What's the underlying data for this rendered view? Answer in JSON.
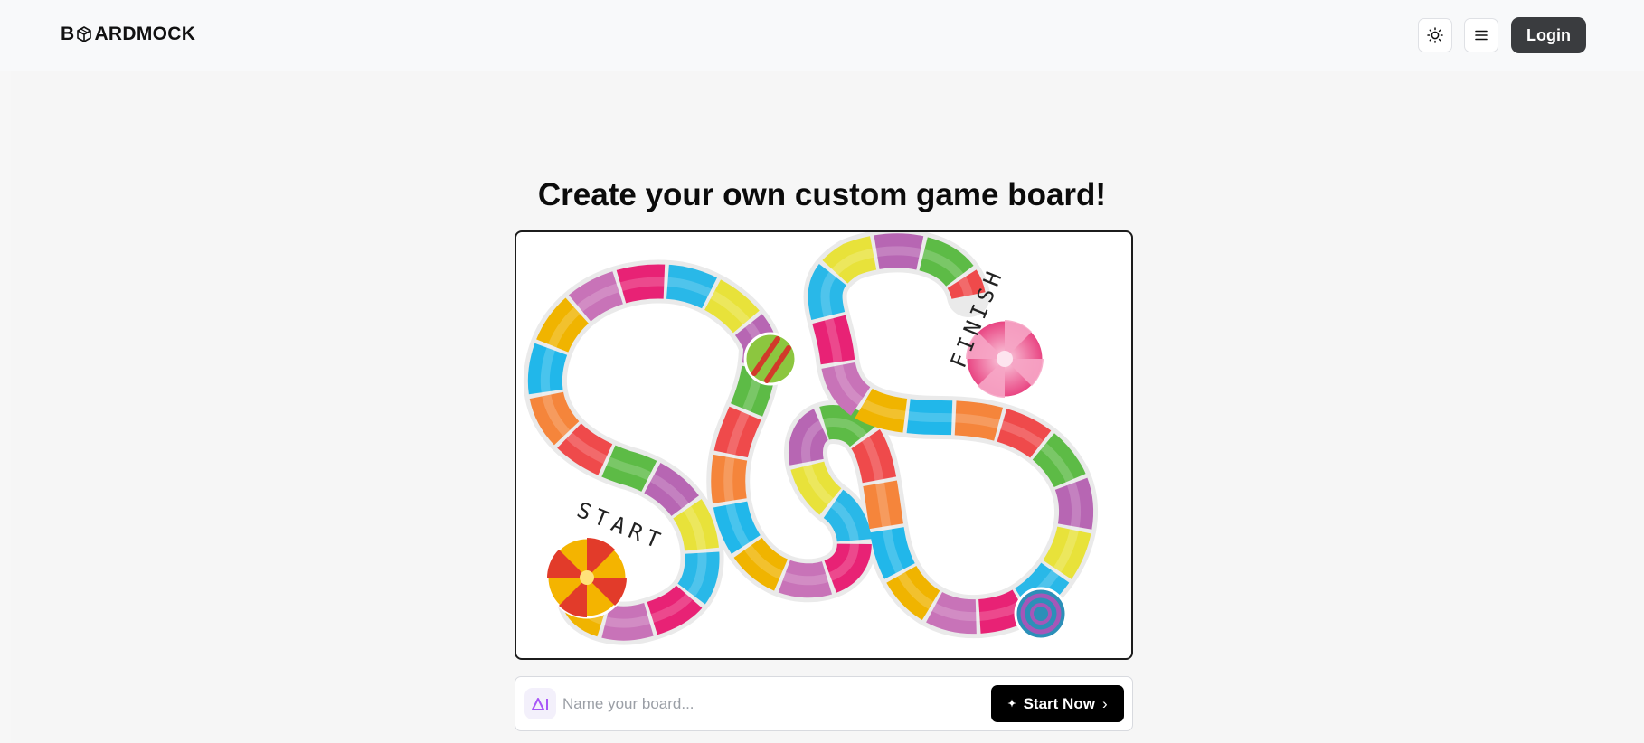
{
  "brand": {
    "pre": "B",
    "post": "ARDMOCK",
    "logo_icon": "cube-icon"
  },
  "header": {
    "theme_icon": "sun-icon",
    "menu_icon": "menu-icon",
    "login_label": "Login"
  },
  "hero": {
    "title": "Create your own custom game board!"
  },
  "board": {
    "start_label": "START",
    "finish_label": "FINISH",
    "path_colors": [
      "#f0b400",
      "#c873b8",
      "#e82275",
      "#29b8e8",
      "#e8e23a",
      "#b766b3",
      "#5dbb46",
      "#ef4a4b",
      "#f5853b",
      "#21b7ea"
    ]
  },
  "prompt": {
    "ai_label": "AI",
    "placeholder": "Name your board...",
    "start_label": "Start Now",
    "sparkle_icon": "sparkle-icon",
    "chevron_icon": "chevron-right-icon"
  }
}
